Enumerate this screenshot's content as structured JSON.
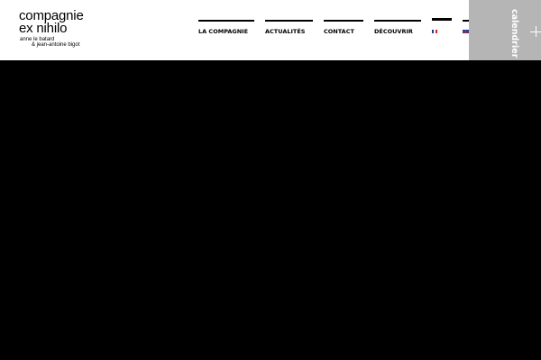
{
  "logo": {
    "line1": "compagnie",
    "line2": "ex nihilo",
    "sub1": "anne le batard",
    "sub2": "& jean-antoine bigot"
  },
  "nav": {
    "items": [
      {
        "label": "LA COMPAGNIE"
      },
      {
        "label": "ACTUALITÉS"
      },
      {
        "label": "CONTACT"
      },
      {
        "label": "DÉCOUVRIR"
      }
    ]
  },
  "languages": [
    {
      "code": "fr",
      "icon": "flag-france-icon",
      "active": true
    },
    {
      "code": "en",
      "icon": "flag-uk-icon",
      "active": false
    }
  ],
  "calendar": {
    "label": "calendrier",
    "icon": "plus-icon"
  },
  "colors": {
    "background": "#000000",
    "header": "#ffffff",
    "calendar_tab": "#b5b5b5",
    "text": "#000000"
  }
}
